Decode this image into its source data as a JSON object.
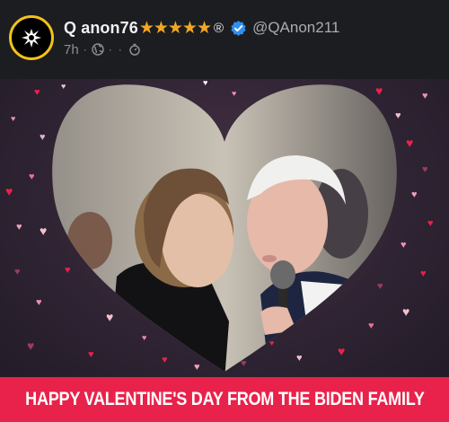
{
  "post": {
    "author": {
      "display_name": "Q anon76",
      "badge_stars": "★★★★★",
      "registered_mark": "®",
      "verified_icon": "verified-check-icon",
      "handle": "@QAnon211"
    },
    "meta": {
      "time": "7h",
      "separator": "·",
      "icons": [
        "globe-icon",
        "ellipsis-dot",
        "timer-icon"
      ]
    },
    "image": {
      "caption": "HAPPY VALENTINE'S DAY FROM THE BIDEN FAMILY",
      "colors": {
        "caption_bar": "#e8224a",
        "background": "#2e2332",
        "heart_accent": "#e8224a"
      }
    }
  }
}
